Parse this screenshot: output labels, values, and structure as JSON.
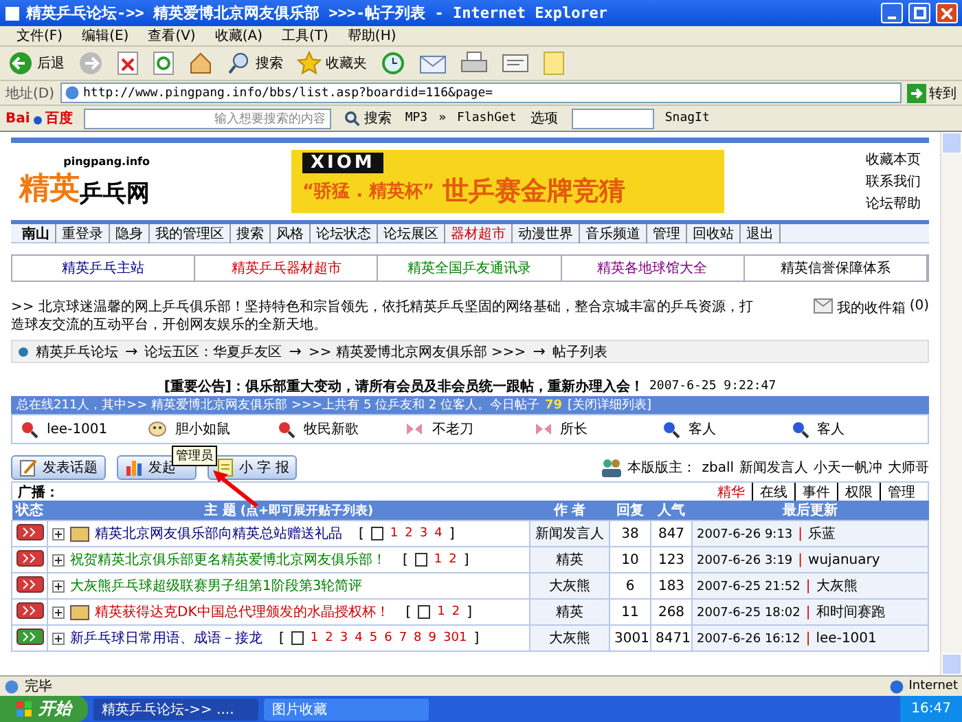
{
  "window": {
    "title": "精英乒乓论坛->> 精英爱博北京网友俱乐部 >>>-帖子列表 - Internet Explorer"
  },
  "menu": [
    "文件(F)",
    "编辑(E)",
    "查看(V)",
    "收藏(A)",
    "工具(T)",
    "帮助(H)"
  ],
  "toolbar": [
    {
      "kind": "back",
      "label": "后退"
    },
    {
      "kind": "forward"
    },
    {
      "kind": "stop"
    },
    {
      "kind": "refresh"
    },
    {
      "kind": "home"
    },
    {
      "kind": "search",
      "label": "搜索"
    },
    {
      "kind": "favorites",
      "label": "收藏夹"
    },
    {
      "kind": "history"
    },
    {
      "kind": "mail"
    },
    {
      "kind": "print"
    },
    {
      "kind": "edit"
    },
    {
      "kind": "note"
    }
  ],
  "address": {
    "label": "地址(D)",
    "url": "http://www.pingpang.info/bbs/list.asp?boardid=116&page=",
    "go": "转到"
  },
  "baidu_bar": {
    "logo_latin": "Bai",
    "logo_cjk": "百度",
    "placeholder": "输入想要搜索的内容",
    "search": "搜索",
    "mp3": "MP3",
    "more": "»",
    "flashget": "FlashGet",
    "options": "选项",
    "snagit": "SnagIt"
  },
  "site": {
    "domain": "pingpang.info",
    "logo_first": "精英",
    "logo_second": "乒乓网",
    "banner_brand": "XIOM",
    "banner_cup": "“骄猛 . 精英杯”",
    "banner_slogan": "世乒赛金牌竞猜",
    "links": [
      "收藏本页",
      "联系我们",
      "论坛帮助"
    ]
  },
  "nav": {
    "user": "南山",
    "items": [
      {
        "label": "重登录",
        "hot": false
      },
      {
        "label": "隐身",
        "hot": false
      },
      {
        "label": "我的管理区",
        "hot": false
      },
      {
        "label": "搜索",
        "hot": false
      },
      {
        "label": "风格",
        "hot": false
      },
      {
        "label": "论坛状态",
        "hot": false
      },
      {
        "label": "论坛展区",
        "hot": false
      },
      {
        "label": "器材超市",
        "hot": true
      },
      {
        "label": "动漫世界",
        "hot": false
      },
      {
        "label": "音乐频道",
        "hot": false
      },
      {
        "label": "管理",
        "hot": false
      },
      {
        "label": "回收站",
        "hot": false
      },
      {
        "label": "退出",
        "hot": false
      }
    ]
  },
  "quick_links": [
    {
      "label": "精英乒乓主站",
      "color": "#000080"
    },
    {
      "label": "精英乒乓器材超市",
      "color": "#cc0000"
    },
    {
      "label": "精英全国乒友通讯录",
      "color": "#008000"
    },
    {
      "label": "精英各地球馆大全",
      "color": "#800080"
    },
    {
      "label": "精英信誉保障体系",
      "color": "#000000"
    }
  ],
  "intro": ">> 北京球迷温馨的网上乒乓俱乐部！坚持特色和宗旨领先，依托精英乒乓坚固的网络基础，整合京城丰富的乒乓资源，打造球友交流的互动平台，开创网友娱乐的全新天地。",
  "inbox": {
    "label": "我的收件箱",
    "count": "(0)"
  },
  "breadcrumb": {
    "separator": "→",
    "items": [
      "精英乒乓论坛",
      "论坛五区：华夏乒友区",
      ">> 精英爱博北京网友俱乐部 >>>",
      "帖子列表"
    ]
  },
  "announcement": {
    "text": "[重要公告]：俱乐部重大变动，请所有会员及非会员统一跟帖，重新办理入会！",
    "time": "2007-6-25 9:22:47"
  },
  "stats": {
    "text": "总在线211人，其中>> 精英爱博北京网友俱乐部 >>>上共有 5 位乒友和 2 位客人。今日帖子",
    "today": "79",
    "link": "[关闭详细列表]"
  },
  "online_users": [
    {
      "name": "lee-1001",
      "kind": "member"
    },
    {
      "name": "胆小如鼠",
      "kind": "face"
    },
    {
      "name": "牧民新歌",
      "kind": "member"
    },
    {
      "name": "不老刀",
      "kind": "admin"
    },
    {
      "name": "所长",
      "kind": "admin"
    },
    {
      "name": "客人",
      "kind": "guest"
    },
    {
      "name": "客人",
      "kind": "guest"
    }
  ],
  "actions": [
    {
      "kind": "post",
      "label": "发表话题"
    },
    {
      "kind": "vote",
      "label": "发起"
    },
    {
      "kind": "note",
      "label": "小 字 报"
    }
  ],
  "tooltip": "管理员",
  "moderators": {
    "label": "本版版主：",
    "names": [
      "zball",
      "新闻发言人",
      "小天一帆冲",
      "大师哥"
    ]
  },
  "broadcast": {
    "label": "广播：",
    "links": [
      {
        "label": "精华",
        "hot": true
      },
      {
        "label": "在线",
        "hot": false
      },
      {
        "label": "事件",
        "hot": false
      },
      {
        "label": "权限",
        "hot": false
      },
      {
        "label": "管理",
        "hot": false
      }
    ]
  },
  "table": {
    "bracket_open": "[",
    "bracket_close": "]",
    "separator": "|",
    "columns": [
      {
        "label": "状态"
      },
      {
        "label": "主 题",
        "note": "(点+即可展开贴子列表)"
      },
      {
        "label": "作 者"
      },
      {
        "label": "回复"
      },
      {
        "label": "人气"
      },
      {
        "label": "最后更新"
      }
    ],
    "rows": [
      {
        "hot": true,
        "folder": true,
        "title": "精英北京网友俱乐部向精英总站赠送礼品",
        "color": "#000080",
        "pages": [
          "1",
          "2",
          "3",
          "4"
        ],
        "author": "新闻发言人",
        "replies": "38",
        "views": "847",
        "date": "2007-6-26 9:13",
        "last_user": "乐蓝"
      },
      {
        "hot": true,
        "folder": false,
        "title": "祝贺精英北京俱乐部更名精英爱博北京网友俱乐部！",
        "color": "#008000",
        "pages": [
          "1",
          "2"
        ],
        "author": "精英",
        "replies": "10",
        "views": "123",
        "date": "2007-6-26 3:19",
        "last_user": "wujanuary"
      },
      {
        "hot": true,
        "folder": false,
        "title": "大灰熊乒乓球超级联赛男子组第1阶段第3轮简评",
        "color": "#008000",
        "pages": [],
        "author": "大灰熊",
        "replies": "6",
        "views": "183",
        "date": "2007-6-25 21:52",
        "last_user": "大灰熊"
      },
      {
        "hot": true,
        "folder": true,
        "title": "精英获得达克DK中国总代理颁发的水晶授权杯！",
        "color": "#cc0000",
        "pages": [
          "1",
          "2"
        ],
        "author": "精英",
        "replies": "11",
        "views": "268",
        "date": "2007-6-25 18:02",
        "last_user": "和时间赛跑"
      },
      {
        "hot": false,
        "folder": false,
        "title": "新乒乓球日常用语、成语－接龙",
        "color": "#000080",
        "pages": [
          "1",
          "2",
          "3",
          "4",
          "5",
          "6",
          "7",
          "8",
          "9",
          "301"
        ],
        "author": "大灰熊",
        "replies": "3001",
        "views": "8471",
        "date": "2007-6-26 16:12",
        "last_user": "lee-1001"
      }
    ]
  },
  "status_bar": {
    "text": "完毕",
    "zone": "Internet"
  },
  "taskbar": {
    "start": "开始",
    "tasks": [
      {
        "label": "精英乒乓论坛->> ....",
        "selected": true
      },
      {
        "label": "图片收藏",
        "selected": false
      }
    ],
    "clock": "16:47"
  }
}
